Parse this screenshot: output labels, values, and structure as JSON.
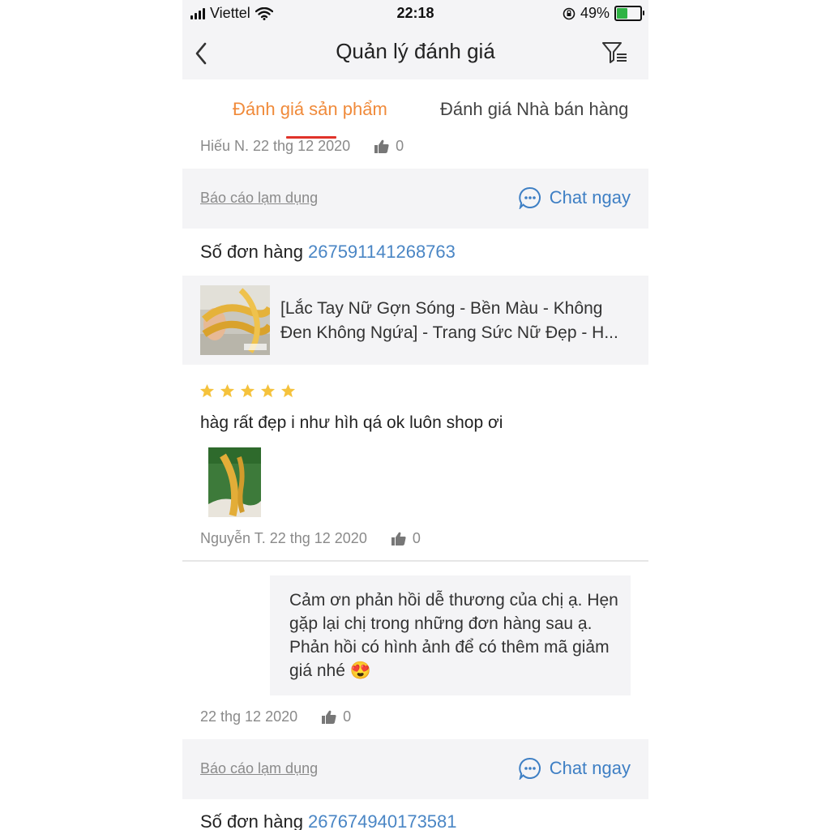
{
  "status_bar": {
    "carrier": "Viettel",
    "time": "22:18",
    "battery": "49%"
  },
  "header": {
    "title": "Quản lý đánh giá"
  },
  "tabs": {
    "product_reviews": "Đánh giá sản phẩm",
    "seller_reviews": "Đánh giá Nhà bán hàng"
  },
  "review_top": {
    "meta": "Hiếu N. 22 thg 12 2020",
    "likes": "0"
  },
  "actions": {
    "report": "Báo cáo lạm dụng",
    "chat": "Chat ngay"
  },
  "order1": {
    "label": "Số đơn hàng",
    "number": "267591141268763"
  },
  "product": {
    "name": "[Lắc Tay Nữ Gợn Sóng - Bền Màu - Không Đen Không Ngứa] - Trang Sức Nữ Đẹp - H..."
  },
  "review": {
    "rating": 5,
    "text": "hàg rất đẹp i như hìh qá ok luôn shop ơi",
    "meta": "Nguyễn T. 22 thg 12 2020",
    "likes": "0"
  },
  "reply": {
    "text": "Cảm ơn phản hồi dễ thương của chị ạ. Hẹn gặp lại chị trong những đơn hàng sau ạ. Phản hồi có hình ảnh để có thêm mã giảm giá nhé 😍",
    "date": "22 thg 12 2020",
    "likes": "0"
  },
  "order2": {
    "label": "Số đơn hàng",
    "number": "267674940173581"
  },
  "colors": {
    "accent_orange": "#f08a3a",
    "underline_red": "#e0332a",
    "link_blue": "#3e7fc4",
    "star_yellow": "#f5c23c"
  },
  "icons": [
    "back-chevron-icon",
    "filter-icon",
    "thumbs-up-icon",
    "chat-bubble-icon",
    "star-icon",
    "wifi-icon",
    "signal-icon",
    "battery-icon",
    "orientation-lock-icon"
  ]
}
